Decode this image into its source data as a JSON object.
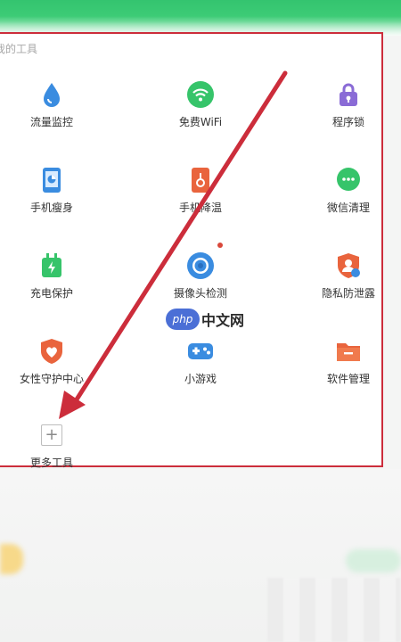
{
  "section": {
    "title": "我的工具"
  },
  "tools": [
    {
      "label": "流量监控",
      "icon": "water-drop-icon"
    },
    {
      "label": "免费WiFi",
      "icon": "wifi-icon"
    },
    {
      "label": "程序锁",
      "icon": "lock-icon"
    },
    {
      "label": "手机瘦身",
      "icon": "phone-slim-icon"
    },
    {
      "label": "手机降温",
      "icon": "thermometer-icon"
    },
    {
      "label": "微信清理",
      "icon": "wechat-icon"
    },
    {
      "label": "充电保护",
      "icon": "battery-charge-icon"
    },
    {
      "label": "摄像头检测",
      "icon": "camera-lens-icon"
    },
    {
      "label": "隐私防泄露",
      "icon": "privacy-shield-icon"
    },
    {
      "label": "女性守护中心",
      "icon": "heart-shield-icon"
    },
    {
      "label": "小游戏",
      "icon": "gamepad-icon"
    },
    {
      "label": "软件管理",
      "icon": "folder-icon"
    },
    {
      "label": "更多工具",
      "icon": "plus-icon"
    }
  ],
  "watermark": {
    "logo": "php",
    "text": "中文网"
  },
  "colors": {
    "accent_green": "#3fce78",
    "annotation_red": "#cc2d3b",
    "blue": "#3a8ce0",
    "purple": "#8a6bd6",
    "orange": "#e9643d"
  }
}
